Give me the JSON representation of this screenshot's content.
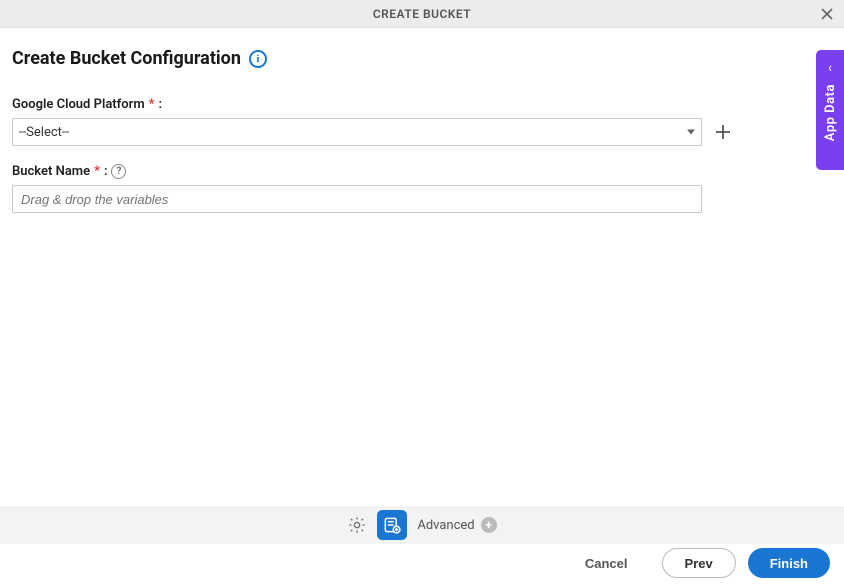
{
  "titlebar": {
    "title": "CREATE BUCKET"
  },
  "page": {
    "heading": "Create Bucket Configuration"
  },
  "fields": {
    "gcp": {
      "label": "Google Cloud Platform",
      "required_marker": "*",
      "colon": ":",
      "selected": "--Select--"
    },
    "bucket_name": {
      "label": "Bucket Name",
      "required_marker": "*",
      "colon": ":",
      "placeholder": "Drag & drop the variables"
    }
  },
  "toolbar": {
    "advanced_label": "Advanced"
  },
  "footer": {
    "cancel": "Cancel",
    "prev": "Prev",
    "finish": "Finish"
  },
  "side_tab": {
    "label": "App Data"
  },
  "icons": {
    "info": "i",
    "help": "?",
    "plus": "+",
    "chevron_left": "‹"
  },
  "colors": {
    "primary": "#1976d2",
    "accent": "#7b3ff2",
    "danger": "#d32f2f"
  }
}
